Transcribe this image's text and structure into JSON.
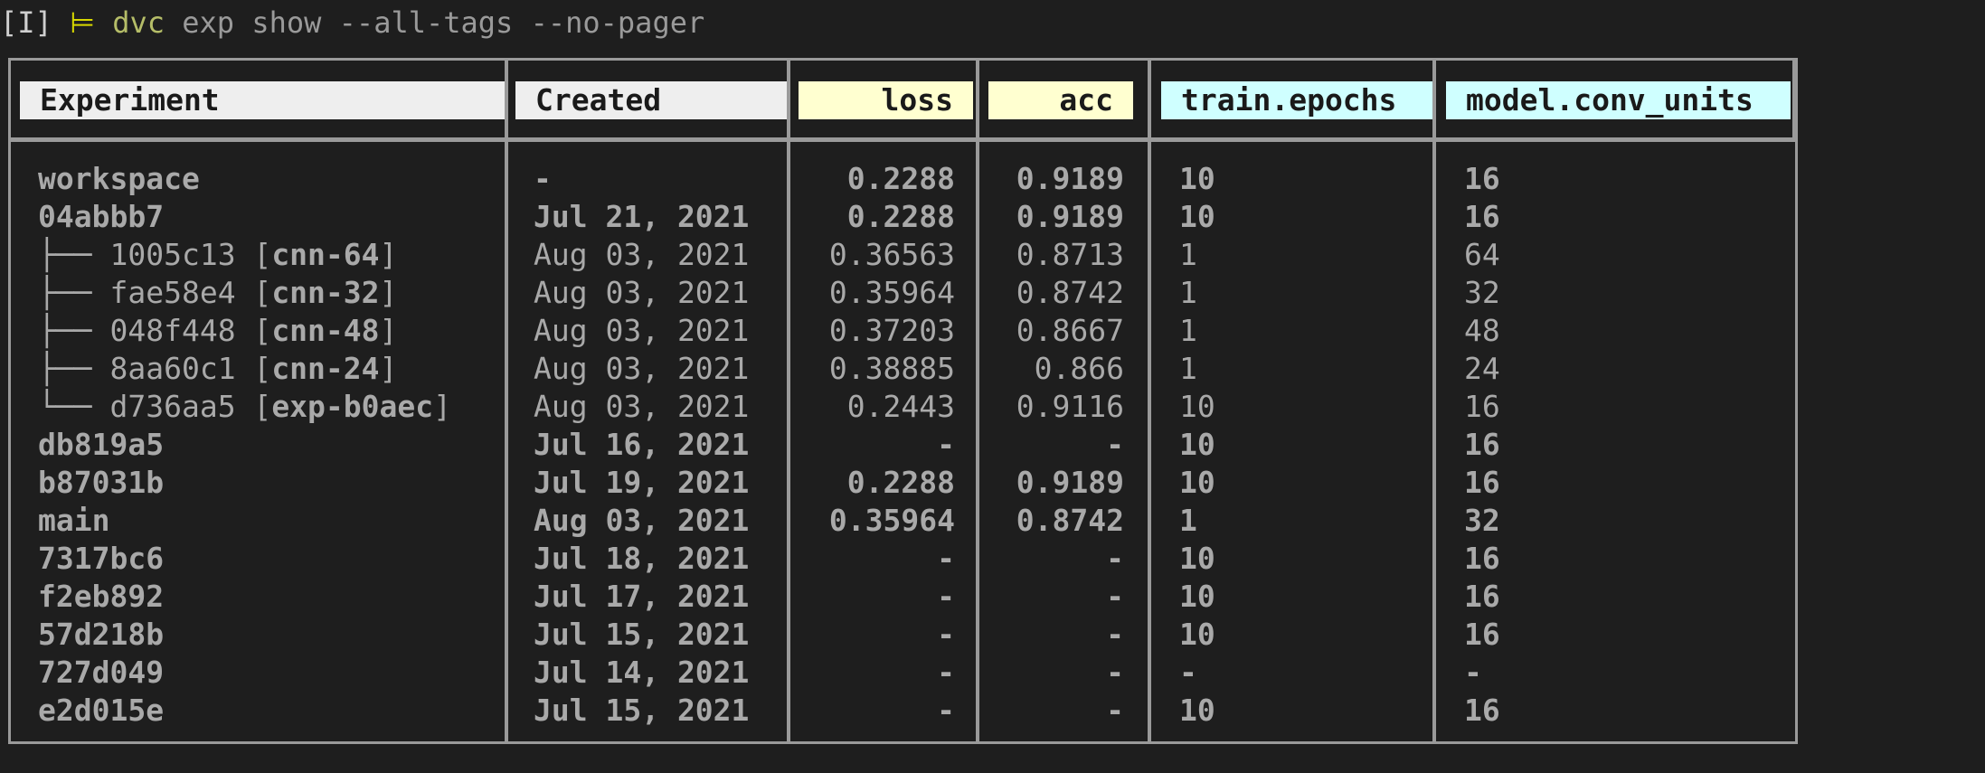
{
  "prompt": {
    "mode": "[I]",
    "arrow": "⊨",
    "command": "dvc",
    "args": "exp show --all-tags --no-pager"
  },
  "colors": {
    "background": "#1e1e1e",
    "header_plain": "#eeeeee",
    "header_metric": "#ffffd0",
    "header_param": "#cfffff",
    "text": "#a9a9a9",
    "border": "#9a9a9a"
  },
  "columns": [
    "Experiment",
    "Created",
    "loss",
    "acc",
    "train.epochs",
    "model.conv_units"
  ],
  "rows": [
    {
      "tree": "",
      "name": "workspace",
      "tag": "",
      "created": "-",
      "loss": "0.2288",
      "acc": "0.9189",
      "epochs": "10",
      "units": "16",
      "bold": true
    },
    {
      "tree": "",
      "name": "04abbb7",
      "tag": "",
      "created": "Jul 21, 2021",
      "loss": "0.2288",
      "acc": "0.9189",
      "epochs": "10",
      "units": "16",
      "bold": true
    },
    {
      "tree": "├── ",
      "name": "1005c13",
      "tag": "cnn-64",
      "created": "Aug 03, 2021",
      "loss": "0.36563",
      "acc": "0.8713",
      "epochs": "1",
      "units": "64",
      "bold": false
    },
    {
      "tree": "├── ",
      "name": "fae58e4",
      "tag": "cnn-32",
      "created": "Aug 03, 2021",
      "loss": "0.35964",
      "acc": "0.8742",
      "epochs": "1",
      "units": "32",
      "bold": false
    },
    {
      "tree": "├── ",
      "name": "048f448",
      "tag": "cnn-48",
      "created": "Aug 03, 2021",
      "loss": "0.37203",
      "acc": "0.8667",
      "epochs": "1",
      "units": "48",
      "bold": false
    },
    {
      "tree": "├── ",
      "name": "8aa60c1",
      "tag": "cnn-24",
      "created": "Aug 03, 2021",
      "loss": "0.38885",
      "acc": "0.866",
      "epochs": "1",
      "units": "24",
      "bold": false
    },
    {
      "tree": "└── ",
      "name": "d736aa5",
      "tag": "exp-b0aec",
      "created": "Aug 03, 2021",
      "loss": "0.2443",
      "acc": "0.9116",
      "epochs": "10",
      "units": "16",
      "bold": false
    },
    {
      "tree": "",
      "name": "db819a5",
      "tag": "",
      "created": "Jul 16, 2021",
      "loss": "-",
      "acc": "-",
      "epochs": "10",
      "units": "16",
      "bold": true
    },
    {
      "tree": "",
      "name": "b87031b",
      "tag": "",
      "created": "Jul 19, 2021",
      "loss": "0.2288",
      "acc": "0.9189",
      "epochs": "10",
      "units": "16",
      "bold": true
    },
    {
      "tree": "",
      "name": "main",
      "tag": "",
      "created": "Aug 03, 2021",
      "loss": "0.35964",
      "acc": "0.8742",
      "epochs": "1",
      "units": "32",
      "bold": true
    },
    {
      "tree": "",
      "name": "7317bc6",
      "tag": "",
      "created": "Jul 18, 2021",
      "loss": "-",
      "acc": "-",
      "epochs": "10",
      "units": "16",
      "bold": true
    },
    {
      "tree": "",
      "name": "f2eb892",
      "tag": "",
      "created": "Jul 17, 2021",
      "loss": "-",
      "acc": "-",
      "epochs": "10",
      "units": "16",
      "bold": true
    },
    {
      "tree": "",
      "name": "57d218b",
      "tag": "",
      "created": "Jul 15, 2021",
      "loss": "-",
      "acc": "-",
      "epochs": "10",
      "units": "16",
      "bold": true
    },
    {
      "tree": "",
      "name": "727d049",
      "tag": "",
      "created": "Jul 14, 2021",
      "loss": "-",
      "acc": "-",
      "epochs": "-",
      "units": "-",
      "bold": true
    },
    {
      "tree": "",
      "name": "e2d015e",
      "tag": "",
      "created": "Jul 15, 2021",
      "loss": "-",
      "acc": "-",
      "epochs": "10",
      "units": "16",
      "bold": true
    }
  ]
}
